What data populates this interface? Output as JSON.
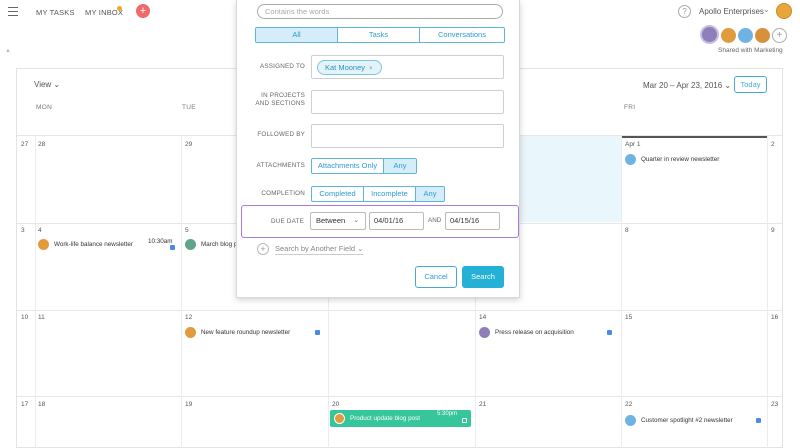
{
  "topnav": {
    "my_tasks": "MY TASKS",
    "my_inbox": "MY INBOX",
    "add": "+",
    "help": "?",
    "org_name": "Apollo Enterprises",
    "org_chevron": "⌄"
  },
  "project": {
    "shared_with": "Shared with Marketing",
    "add_member": "+"
  },
  "calendar": {
    "view_label": "View ⌄",
    "date_range": "Mar 20 – Apr 23, 2016 ⌄",
    "today_label": "Today",
    "days": [
      "MON",
      "TUE",
      "FRI"
    ],
    "weeks": [
      {
        "week": "27",
        "mon": "28",
        "tue": "29",
        "fri": "Apr 1",
        "sat": "2"
      },
      {
        "week": "3",
        "mon": "4",
        "tue": "5",
        "fri": "8",
        "sat": "9"
      },
      {
        "week": "10",
        "mon": "11",
        "tue": "12",
        "thu": "14",
        "fri": "15",
        "sat": "16"
      },
      {
        "week": "17",
        "mon": "18",
        "tue": "19",
        "wed": "20",
        "thu": "21",
        "fri": "22",
        "sat": "23"
      }
    ],
    "events": {
      "quarter_review": "Quarter in review newsletter",
      "work_life": "Work-life balance newsletter",
      "work_life_time": "10:30am",
      "march_blog": "March blog p",
      "feature_roundup": "New feature roundup newsletter",
      "press_release": "Press release on acquisition",
      "product_update": "Product update blog post",
      "product_update_time": "5:30pm",
      "customer_spotlight": "Customer spotlight #2 newsletter"
    }
  },
  "search_panel": {
    "contains_placeholder": "Contains the words",
    "scope_tabs": [
      "All",
      "Tasks",
      "Conversations"
    ],
    "assigned_to_label": "ASSIGNED TO",
    "assigned_to_token": "Kat Mooney",
    "token_remove": "×",
    "projects_label_1": "IN PROJECTS",
    "projects_label_2": "AND SECTIONS",
    "followed_by_label": "FOLLOWED BY",
    "attachments_label": "ATTACHMENTS",
    "attachments_options": [
      "Attachments Only",
      "Any"
    ],
    "completion_label": "COMPLETION",
    "completion_options": [
      "Completed",
      "Incomplete",
      "Any"
    ],
    "due_date_label": "DUE DATE",
    "due_date_mode": "Between",
    "due_date_chevron": "⌄",
    "due_date_from": "04/01/16",
    "due_date_and": "AND",
    "due_date_to": "04/15/16",
    "another_field": "Search by Another Field ⌄",
    "another_plus": "+",
    "cancel": "Cancel",
    "search": "Search"
  },
  "colors": {
    "accent": "#25b0d6",
    "green_event": "#37c59b",
    "due_highlight": "#a77bd9",
    "today_bg": "#e9f6fb"
  }
}
